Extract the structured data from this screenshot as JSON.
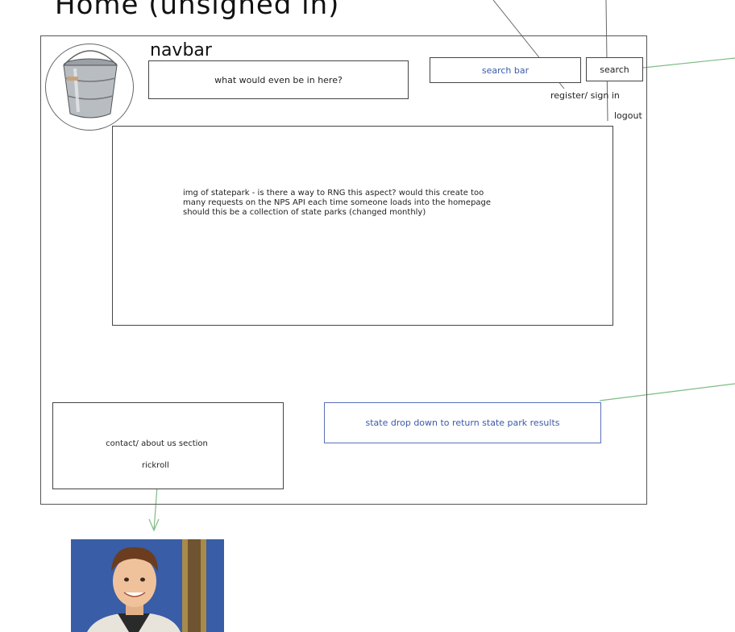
{
  "page_title": "Home (unsigned in)",
  "navbar": {
    "label": "navbar",
    "content_note": "what would even be in here?",
    "search_placeholder": "search bar",
    "search_button": "search",
    "register_link": "register/ sign in",
    "logout_link": "logout"
  },
  "hero": {
    "line1": "img of statepark - is there a way to RNG this aspect? would this create too",
    "line2": "many requests on the NPS API each time someone loads into the homepage",
    "line3": "should this be a collection of state parks (changed monthly)"
  },
  "contact": {
    "label": "contact/ about us section",
    "rickroll": "rickroll"
  },
  "state_dropdown": {
    "label": "state drop down to return state park results"
  },
  "icons": {
    "logo": "bucket-icon",
    "rickroll_image": "rick-astley-image"
  },
  "colors": {
    "link_blue": "#3a5aa8",
    "annotation_green": "#7dbb84"
  }
}
